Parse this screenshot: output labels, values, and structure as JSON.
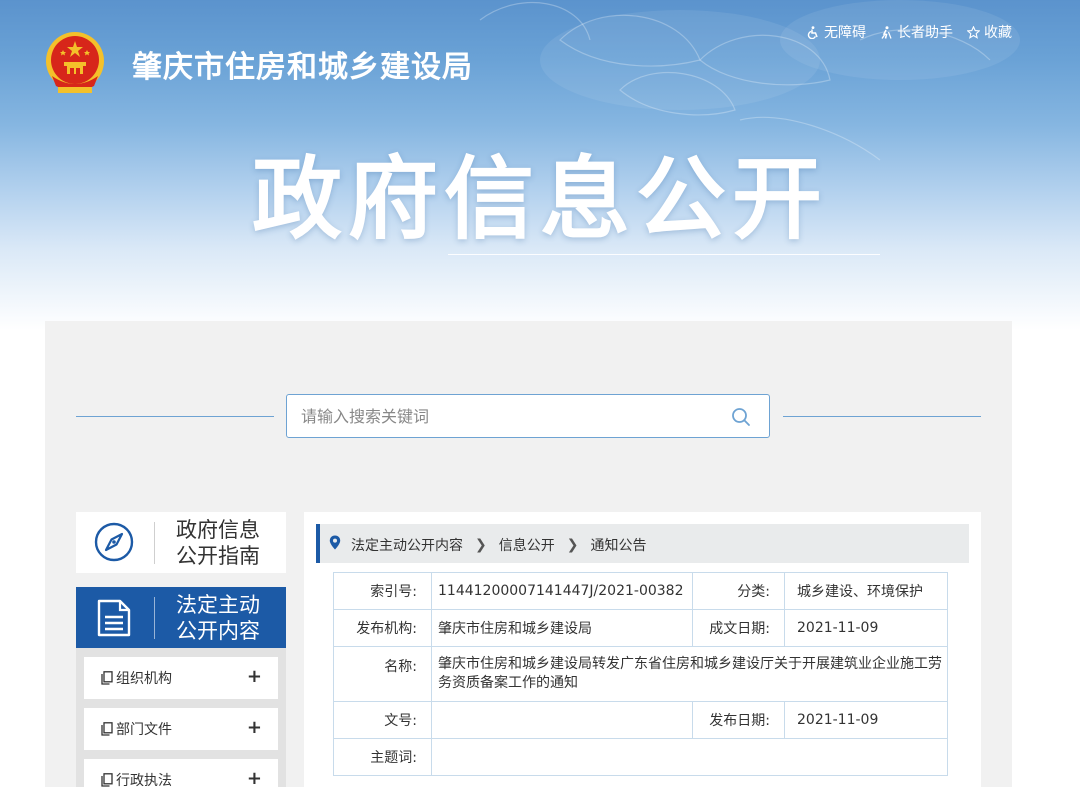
{
  "header": {
    "site_name": "肇庆市住房和城乡建设局",
    "banner_title": "政府信息公开",
    "top_links": [
      {
        "label": "无障碍",
        "icon": "accessibility-icon"
      },
      {
        "label": "长者助手",
        "icon": "elder-assist-icon"
      },
      {
        "label": "收藏",
        "icon": "star-icon"
      }
    ]
  },
  "search": {
    "placeholder": "请输入搜索关键词",
    "value": ""
  },
  "sidebar": {
    "guide": {
      "line1": "政府信息",
      "line2": "公开指南"
    },
    "active": {
      "line1": "法定主动",
      "line2": "公开内容"
    },
    "items": [
      {
        "label": "组织机构",
        "expander": "+"
      },
      {
        "label": "部门文件",
        "expander": "+"
      },
      {
        "label": "行政执法",
        "expander": "+"
      }
    ]
  },
  "breadcrumb": [
    "法定主动公开内容",
    "信息公开",
    "通知公告"
  ],
  "meta": {
    "index_label": "索引号:",
    "index_value": "11441200007141447J/2021-00382",
    "category_label": "分类:",
    "category_value": "城乡建设、环境保护",
    "publisher_label": "发布机构:",
    "publisher_value": "肇庆市住房和城乡建设局",
    "created_label": "成文日期:",
    "created_value": "2021-11-09",
    "name_label": "名称:",
    "name_value": "肇庆市住房和城乡建设局转发广东省住房和城乡建设厅关于开展建筑业企业施工劳务资质备案工作的通知",
    "docno_label": "文号:",
    "docno_value": "",
    "published_label": "发布日期:",
    "published_value": "2021-11-09",
    "subject_label": "主题词:",
    "subject_value": ""
  },
  "colors": {
    "brand_blue": "#1c5aa6",
    "line_blue": "#6ea3d3",
    "emblem_red": "#d7261a",
    "emblem_gold": "#f4c12a"
  }
}
